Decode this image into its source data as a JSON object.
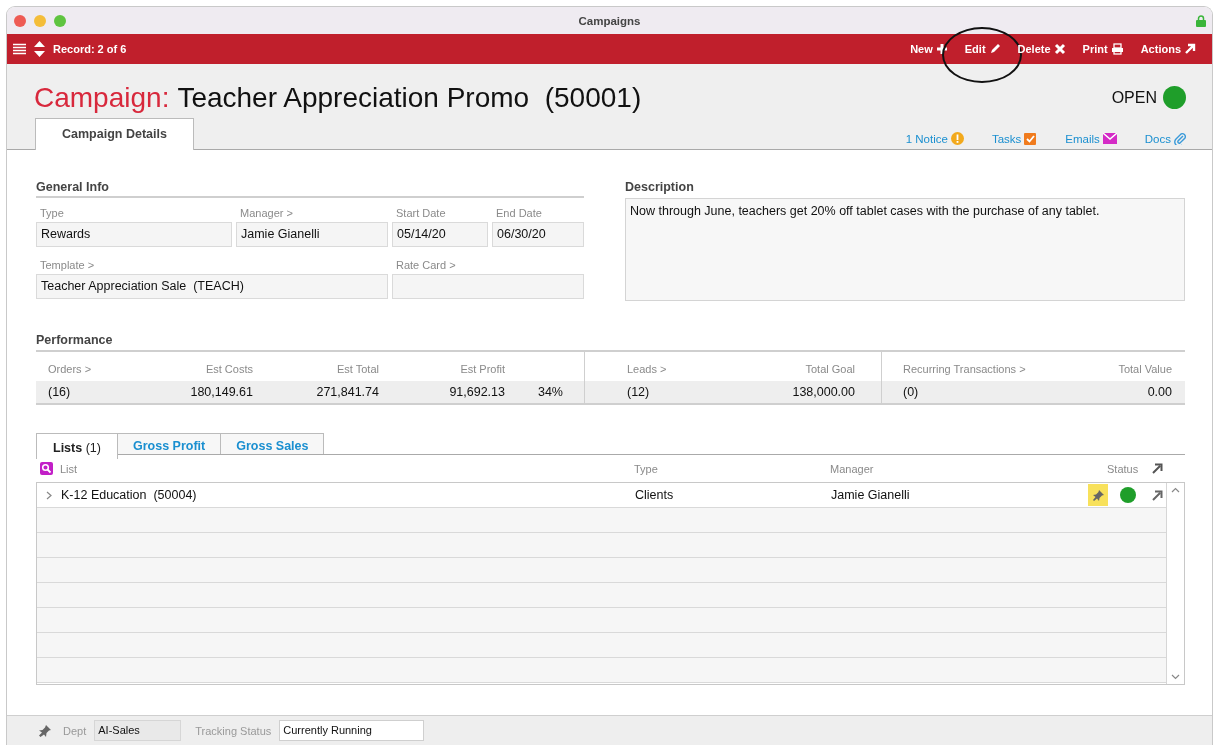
{
  "window": {
    "title": "Campaigns",
    "locked": true
  },
  "toolbar": {
    "record": "Record: 2 of 6",
    "actions": [
      {
        "label": "New",
        "circled": false
      },
      {
        "label": "Edit",
        "circled": true
      },
      {
        "label": "Delete",
        "circled": false
      },
      {
        "label": "Print",
        "circled": false
      },
      {
        "label": "Actions",
        "circled": false
      }
    ]
  },
  "record": {
    "label": "Campaign:",
    "title": "Teacher Appreciation Promo  (50001)",
    "status": {
      "text": "OPEN",
      "color": "#1f9e2a"
    }
  },
  "tabs": [
    {
      "label": "Campaign Details",
      "selected": true
    }
  ],
  "links": [
    {
      "label": "1 Notice"
    },
    {
      "label": "Tasks"
    },
    {
      "label": "Emails"
    },
    {
      "label": "Docs"
    }
  ],
  "general_info": {
    "heading": "General Info",
    "rows": [
      [
        {
          "label": "Type",
          "value": "Rewards"
        },
        {
          "label": "Manager >",
          "value": "Jamie Gianelli"
        },
        {
          "label": "Start Date",
          "value": "05/14/20"
        },
        {
          "label": "End Date",
          "value": "06/30/20"
        }
      ],
      [
        {
          "label": "Template >",
          "value": "Teacher Appreciation Sale  (TEACH)"
        },
        "",
        {
          "label": "Rate Card >"
        },
        ""
      ]
    ]
  },
  "description": {
    "heading": "Description",
    "text": "Now through June, teachers get 20% off tablet cases with the purchase of any tablet."
  },
  "performance": {
    "heading": "Performance",
    "groups": [
      {
        "columns": [
          {
            "label": "Orders >",
            "value": "(16)"
          },
          {
            "label": "Est Costs",
            "value": "180,149.61"
          },
          {
            "label": "Est Total",
            "value": "271,841.74"
          },
          {
            "label": "Est Profit",
            "value": "91,692.13"
          },
          {
            "value": "34%"
          }
        ]
      },
      {
        "columns": [
          {
            "label": "Leads >",
            "value": "(12)"
          },
          {
            "label": "Total Goal",
            "value": "138,000.00"
          }
        ]
      },
      {
        "columns": [
          {
            "label": "Recurring Transactions >",
            "value": "(0)"
          },
          {
            "label": "Total Value",
            "value": "0.00"
          }
        ]
      }
    ]
  },
  "lists": {
    "tabs": [
      {
        "label": "Lists",
        "count": "(1)",
        "selected": true
      },
      {
        "label": "Gross Profit",
        "selected": false
      },
      {
        "label": "Gross Sales",
        "selected": false
      }
    ],
    "columns": [
      "List",
      "Type",
      "Manager",
      "Status"
    ],
    "rows": [
      {
        "cells": [
          "K-12 Education  (50004)",
          "Clients",
          "Jamie Gianelli"
        ],
        "pinned": true,
        "color": "#1f9e2a"
      }
    ]
  },
  "footer": {
    "fields": [
      {
        "label": "Dept",
        "value": "AI-Sales",
        "editable": false
      },
      {
        "label": "Tracking Status",
        "value": "Currently Running",
        "editable": true
      }
    ]
  }
}
